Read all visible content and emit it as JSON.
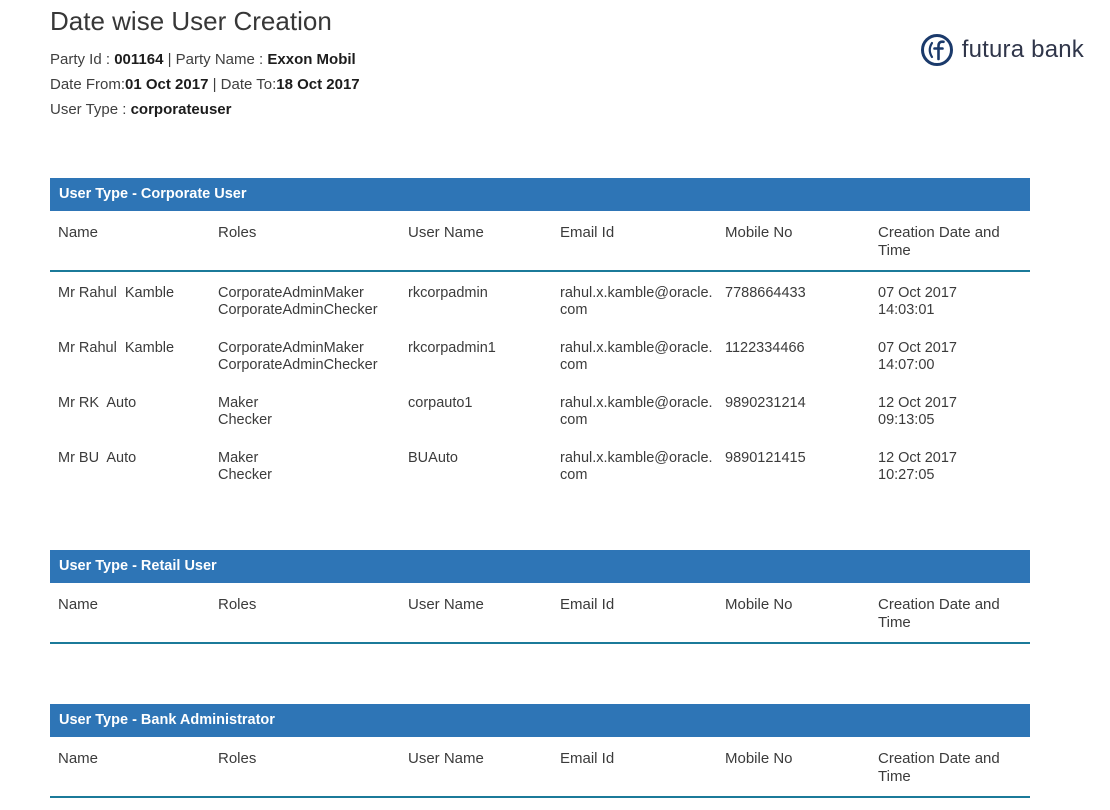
{
  "report": {
    "title": "Date wise User Creation",
    "party_id_label": "Party Id : ",
    "party_id_value": "001164",
    "party_sep": " | ",
    "party_name_label": "Party Name : ",
    "party_name_value": "Exxon Mobil",
    "date_from_label": "Date From:",
    "date_from_value": "01 Oct 2017",
    "date_sep": " | ",
    "date_to_label": "Date To:",
    "date_to_value": "18 Oct 2017",
    "user_type_label": "User Type : ",
    "user_type_value": "corporateuser"
  },
  "brand": {
    "name": "futura bank"
  },
  "colors": {
    "table_title_bar": "#2e75b6",
    "header_rule": "#1b7a99",
    "brand_navy": "#1b3a6b"
  },
  "columns": [
    "Name",
    "Roles",
    "User Name",
    "Email Id",
    "Mobile No",
    "Creation Date and Time"
  ],
  "tables": {
    "corporate": {
      "title": "User Type - Corporate User",
      "rows": [
        {
          "name": "Mr Rahul  Kamble",
          "roles": [
            "CorporateAdminMaker",
            "CorporateAdminChecker"
          ],
          "user_name": "rkcorpadmin",
          "email": "rahul.x.kamble@oracle.com",
          "mobile": "7788664433",
          "created": [
            "07 Oct 2017",
            "14:03:01"
          ]
        },
        {
          "name": "Mr Rahul  Kamble",
          "roles": [
            "CorporateAdminMaker",
            "CorporateAdminChecker"
          ],
          "user_name": "rkcorpadmin1",
          "email": "rahul.x.kamble@oracle.com",
          "mobile": "1122334466",
          "created": [
            "07 Oct 2017",
            "14:07:00"
          ]
        },
        {
          "name": "Mr RK  Auto",
          "roles": [
            "Maker",
            "Checker"
          ],
          "user_name": "corpauto1",
          "email": "rahul.x.kamble@oracle.com",
          "mobile": "9890231214",
          "created": [
            "12 Oct 2017",
            "09:13:05"
          ]
        },
        {
          "name": "Mr BU  Auto",
          "roles": [
            "Maker",
            "Checker"
          ],
          "user_name": "BUAuto",
          "email": "rahul.x.kamble@oracle.com",
          "mobile": "9890121415",
          "created": [
            "12 Oct 2017",
            "10:27:05"
          ]
        }
      ]
    },
    "retail": {
      "title": "User Type - Retail User",
      "rows": []
    },
    "bank_admin": {
      "title": "User Type - Bank Administrator",
      "rows": []
    }
  }
}
